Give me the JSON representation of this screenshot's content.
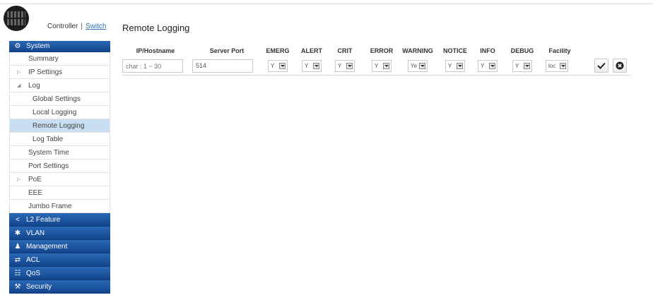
{
  "header": {
    "controller_label": "Controller",
    "separator": "|",
    "switch_label": "Switch"
  },
  "sidebar": {
    "system": {
      "label": "System",
      "icon": "gear-icon"
    },
    "items": [
      {
        "label": "Summary"
      },
      {
        "label": "IP Settings"
      },
      {
        "label": "Log"
      },
      {
        "label": "Global Settings"
      },
      {
        "label": "Local Logging"
      },
      {
        "label": "Remote Logging"
      },
      {
        "label": "Log Table"
      },
      {
        "label": "System Time"
      },
      {
        "label": "Port Settings"
      },
      {
        "label": "PoE"
      },
      {
        "label": "EEE"
      },
      {
        "label": "Jumbo Frame"
      }
    ],
    "categories": [
      {
        "label": "L2 Feature",
        "icon": "share-icon"
      },
      {
        "label": "VLAN",
        "icon": "network-icon"
      },
      {
        "label": "Management",
        "icon": "user-icon"
      },
      {
        "label": "ACL",
        "icon": "shuffle-icon"
      },
      {
        "label": "QoS",
        "icon": "sitemap-icon"
      },
      {
        "label": "Security",
        "icon": "wrench-icon"
      }
    ]
  },
  "main": {
    "title": "Remote Logging",
    "columns": [
      "IP/Hostname",
      "Server Port",
      "EMERG",
      "ALERT",
      "CRIT",
      "ERROR",
      "WARNING",
      "NOTICE",
      "INFO",
      "DEBUG",
      "Facility"
    ],
    "row": {
      "hostname_placeholder": "char : 1 ~ 30",
      "server_port": "514",
      "emerg": "Y",
      "alert": "Y",
      "crit": "Y",
      "error": "Y",
      "warning": "Ye",
      "notice": "Y",
      "info": "Y",
      "debug": "Y",
      "facility": "loc"
    }
  },
  "colors": {
    "nav_blue": "#1a4f9c",
    "active_item": "#c9def3"
  }
}
